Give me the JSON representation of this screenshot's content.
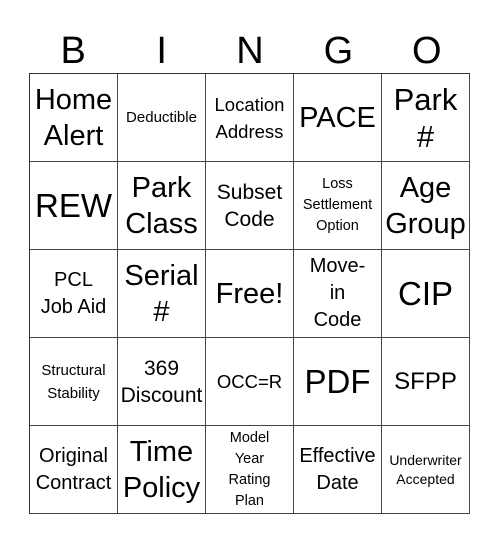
{
  "header": {
    "letters": [
      "B",
      "I",
      "N",
      "G",
      "O"
    ]
  },
  "board": {
    "rows": [
      [
        "Home\nAlert",
        "Deductible",
        "Location\nAddress",
        "PACE",
        "Park\n#"
      ],
      [
        "REW",
        "Park\nClass",
        "Subset\nCode",
        "Loss\nSettlement\nOption",
        "Age\nGroup"
      ],
      [
        "PCL\nJob Aid",
        "Serial\n#",
        "Free!",
        "Move-\nin\nCode",
        "CIP"
      ],
      [
        "Structural\nStability",
        "369\nDiscount",
        "OCC=R",
        "PDF",
        "SFPP"
      ],
      [
        "Original\nContract",
        "Time\nPolicy",
        "Model\nYear\nRating\nPlan",
        "Effective\nDate",
        "Underwriter\nAccepted"
      ]
    ]
  }
}
